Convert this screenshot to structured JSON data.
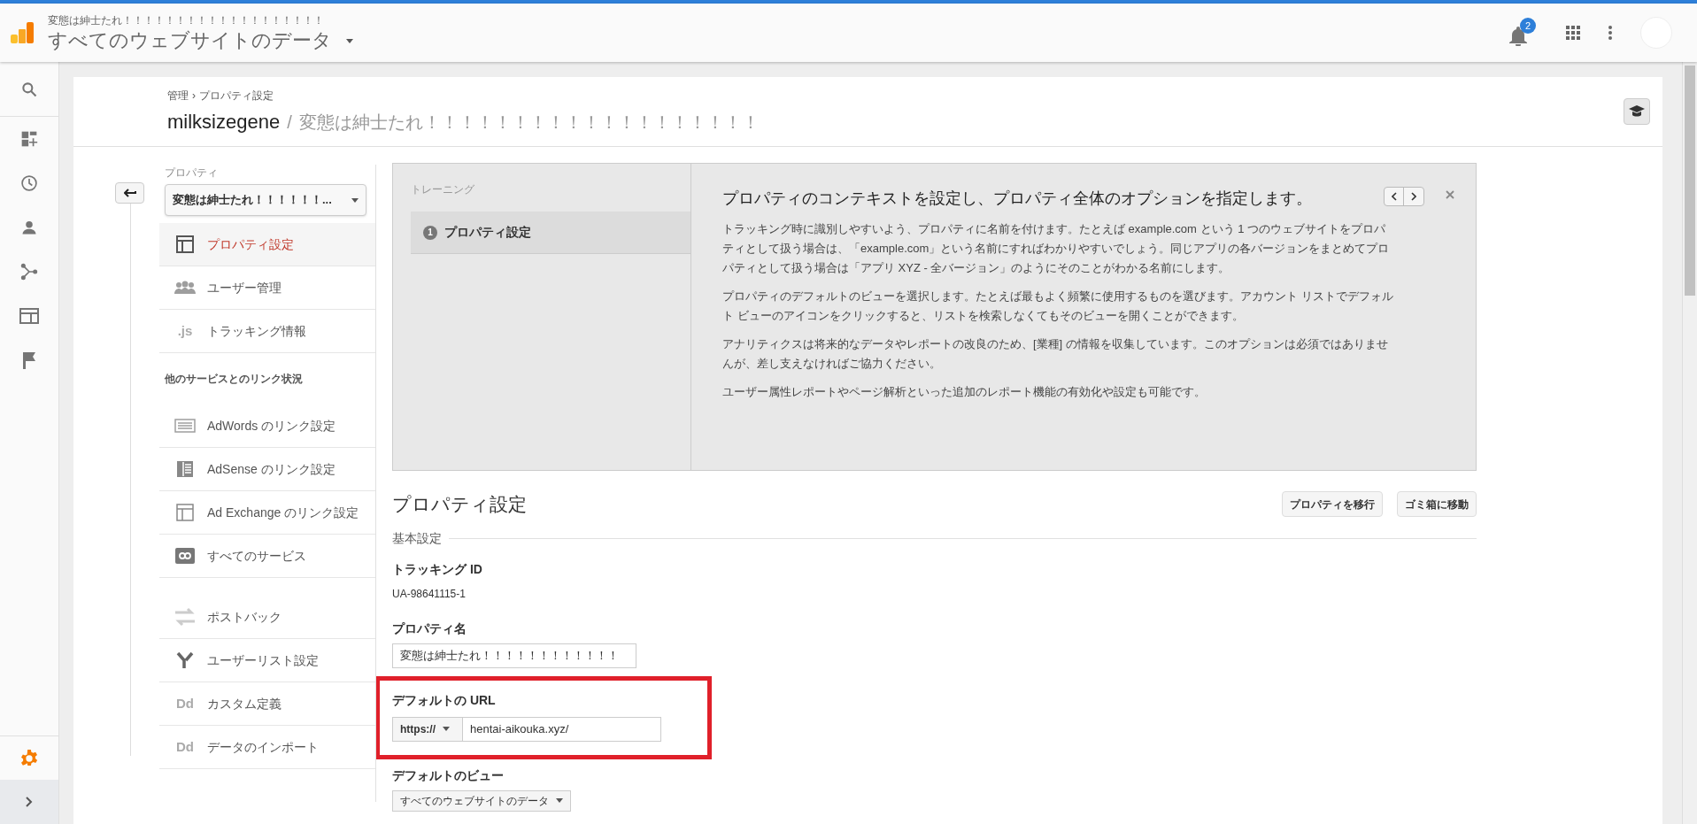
{
  "header": {
    "account_label": "変態は紳士たれ！！！！！！！！！！！！！！！！！！！",
    "view_title": "すべてのウェブサイトのデータ",
    "notification_count": "2"
  },
  "breadcrumb": {
    "items": [
      "管理",
      "プロパティ設定"
    ],
    "separator": "›"
  },
  "page_title": {
    "account": "milksizegene",
    "separator": "/",
    "property": "変態は紳士たれ！！！！！！！！！！！！！！！！！！！"
  },
  "nav": {
    "property_label": "プロパティ",
    "property_select": "変態は紳士たれ！！！！！！...",
    "items": [
      {
        "label": "プロパティ設定",
        "selected": true
      },
      {
        "label": "ユーザー管理",
        "selected": false
      },
      {
        "label": "トラッキング情報",
        "icon_text": ".js",
        "selected": false
      }
    ],
    "section_heading": "他のサービスとのリンク状況",
    "links": [
      {
        "label": "AdWords のリンク設定"
      },
      {
        "label": "AdSense のリンク設定"
      },
      {
        "label": "Ad Exchange のリンク設定"
      },
      {
        "label": "すべてのサービス"
      }
    ],
    "more": [
      {
        "label": "ポストバック"
      },
      {
        "label": "ユーザーリスト設定"
      },
      {
        "label": "カスタム定義",
        "icon_text": "Dd"
      },
      {
        "label": "データのインポート",
        "icon_text": "Dd"
      }
    ]
  },
  "training": {
    "label": "トレーニング",
    "step_number": "1",
    "step_label": "プロパティ設定",
    "heading": "プロパティのコンテキストを設定し、プロパティ全体のオプションを指定します。",
    "paragraphs": [
      "トラッキング時に識別しやすいよう、プロパティに名前を付けます。たとえば example.com という 1 つのウェブサイトをプロパティとして扱う場合は、「example.com」という名前にすればわかりやすいでしょう。同じアプリの各バージョンをまとめてプロパティとして扱う場合は「アプリ XYZ - 全バージョン」のようにそのことがわかる名前にします。",
      "プロパティのデフォルトのビューを選択します。たとえば最もよく頻繁に使用するものを選びます。アカウント リストでデフォルト ビューのアイコンをクリックすると、リストを検索しなくてもそのビューを開くことができます。",
      "アナリティクスは将来的なデータやレポートの改良のため、[業種] の情報を収集しています。このオプションは必須ではありませんが、差し支えなければご協力ください。",
      "ユーザー属性レポートやページ解析といった追加のレポート機能の有効化や設定も可能です。"
    ]
  },
  "form": {
    "title": "プロパティ設定",
    "buttons": [
      "プロパティを移行",
      "ゴミ箱に移動"
    ],
    "section": "基本設定",
    "tracking_id": {
      "label": "トラッキング ID",
      "value": "UA-98641115-1"
    },
    "property_name": {
      "label": "プロパティ名",
      "value": "変態は紳士たれ！！！！！！！！！！！！"
    },
    "default_url": {
      "label": "デフォルトの URL",
      "protocol": "https://",
      "value": "hentai-aikouka.xyz/"
    },
    "default_view": {
      "label": "デフォルトのビュー",
      "value": "すべてのウェブサイトのデータ"
    }
  }
}
